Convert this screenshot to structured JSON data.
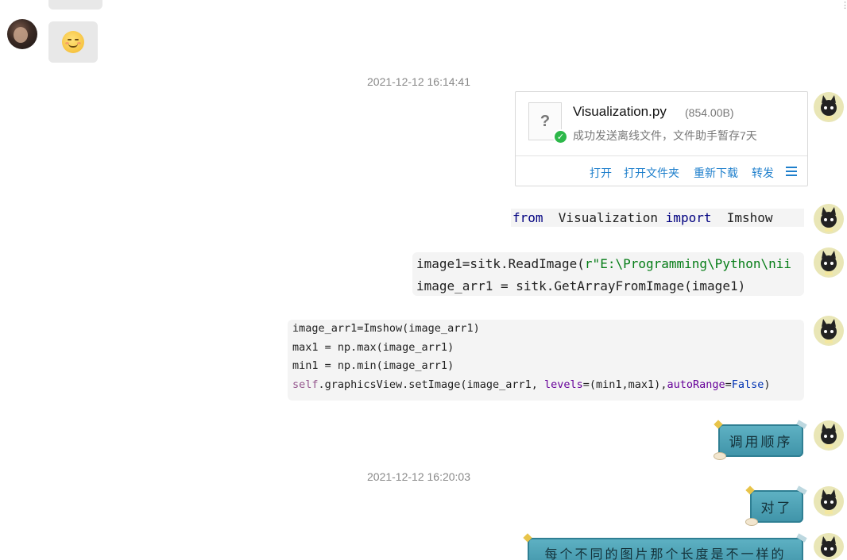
{
  "top_marker": "⋮",
  "messages": {
    "timestamp_1": "2021-12-12 16:14:41",
    "timestamp_2": "2021-12-12 16:20:03",
    "emoji_name": "blush-smile-emoji",
    "file": {
      "name": "Visualization.py",
      "size": "(854.00B)",
      "icon_glyph": "?",
      "status": "成功发送离线文件，文件助手暂存7天",
      "actions": [
        "打开",
        "打开文件夹",
        "重新下载",
        "转发"
      ]
    },
    "code_1": {
      "kw_from": "from",
      "module": "Visualization",
      "kw_import": "import",
      "name": "Imshow"
    },
    "code_2": {
      "line1_a": "image1=sitk.ReadImage(",
      "line1_b": "r\"E:\\Programming\\Python\\nii",
      "line2": "image_arr1 = sitk.GetArrayFromImage(image1)"
    },
    "code_3": {
      "line1": "image_arr1=Imshow(image_arr1)",
      "line2": "max1 = np.max(image_arr1)",
      "line3": "min1 = np.min(image_arr1)",
      "line4_self": "self",
      "line4_a": ".graphicsView.setImage(image_arr1, ",
      "line4_levels": "levels",
      "line4_b": "=(min1,max1),",
      "line4_auto": "autoRange",
      "line4_c": "=",
      "line4_false": "False",
      "line4_d": ")"
    },
    "sticker_1": "调用顺序",
    "sticker_2": "对了",
    "sticker_3": "每个不同的图片那个长度是不一样的"
  },
  "colors": {
    "link_blue": "#1e7fcc",
    "check_green": "#2db84a",
    "sticker_teal": "#4fa3b6",
    "bubble_gray": "#e8e8e8"
  }
}
